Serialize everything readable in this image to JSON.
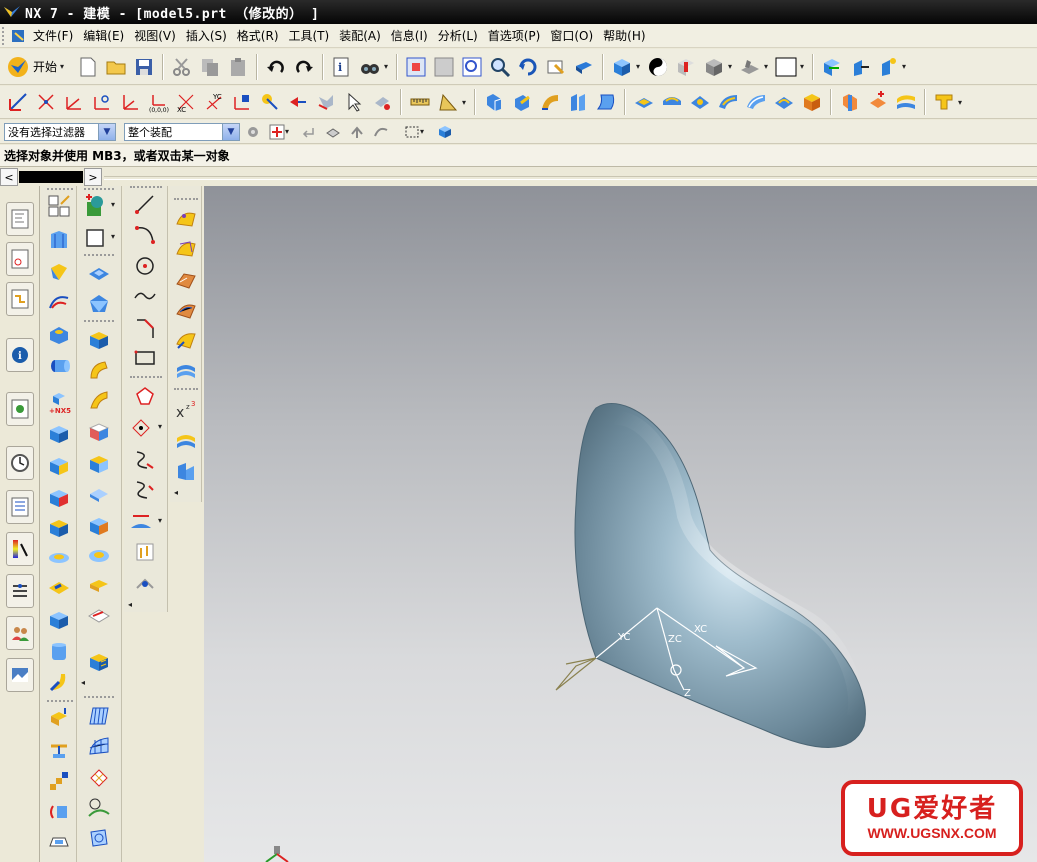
{
  "window": {
    "title": "NX 7 - 建模 - [model5.prt （修改的） ]"
  },
  "menu": {
    "items": [
      "文件(F)",
      "编辑(E)",
      "视图(V)",
      "插入(S)",
      "格式(R)",
      "工具(T)",
      "装配(A)",
      "信息(I)",
      "分析(L)",
      "首选项(P)",
      "窗口(O)",
      "帮助(H)"
    ]
  },
  "toolbar": {
    "start_label": "开始"
  },
  "selection": {
    "filter_value": "没有选择过滤器",
    "scope_value": "整个装配"
  },
  "cue_line": "选择对象并使用 MB3，或者双击某一对象",
  "triad": {
    "labels": [
      "YC",
      "ZC",
      "XC",
      "Z"
    ]
  },
  "watermark": {
    "brand": "UG爱好者",
    "url": "WWW.UGSNX.COM"
  },
  "colors": {
    "surface": "#7d9aab",
    "title_bg": "#0a0a0a",
    "watermark_red": "#d7201e",
    "chrome_bg": "#ece9d8"
  }
}
